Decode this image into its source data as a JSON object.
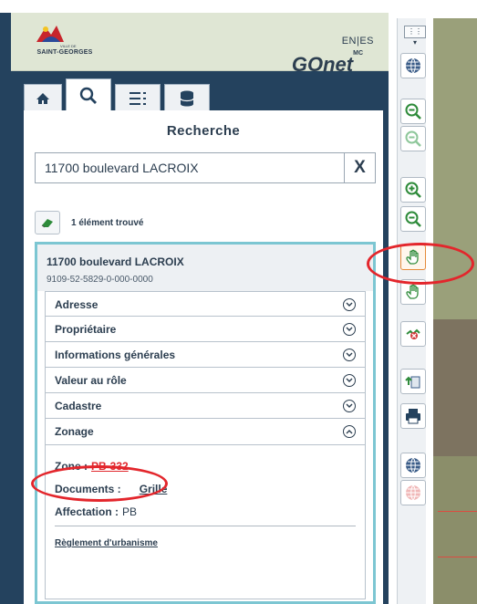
{
  "header": {
    "logo_line1": "VILLE DE",
    "logo_line2": "SAINT-GEORGES",
    "lang": "EN|ES",
    "app_name": "GOnet",
    "app_suffix": "MC"
  },
  "tabs": [
    {
      "name": "home",
      "icon": "home-icon"
    },
    {
      "name": "search",
      "icon": "search-icon",
      "active": true
    },
    {
      "name": "layers",
      "icon": "list-icon"
    },
    {
      "name": "database",
      "icon": "database-icon"
    }
  ],
  "search": {
    "title": "Recherche",
    "query": "11700 boulevard LACROIX",
    "clear_label": "X",
    "result_count": "1 élément trouvé"
  },
  "result": {
    "title": "11700 boulevard LACROIX",
    "matricule": "9109-52-5829-0-000-0000",
    "sections": [
      {
        "label": "Adresse"
      },
      {
        "label": "Propriétaire"
      },
      {
        "label": "Informations générales"
      },
      {
        "label": "Valeur au rôle"
      },
      {
        "label": "Cadastre"
      },
      {
        "label": "Zonage"
      }
    ],
    "zonage": {
      "zone_label": "Zone :",
      "zone_value": "PB-332",
      "documents_label": "Documents :",
      "documents_link": "Grille",
      "affectation_label": "Affectation :",
      "affectation_value": "PB",
      "reglement_link": "Règlement d'urbanisme"
    }
  },
  "colors": {
    "panel": "#24425e",
    "accent_cyan": "#7cc6d2",
    "highlight_red": "#e3262c",
    "zoom_green": "#2e8b3a"
  }
}
